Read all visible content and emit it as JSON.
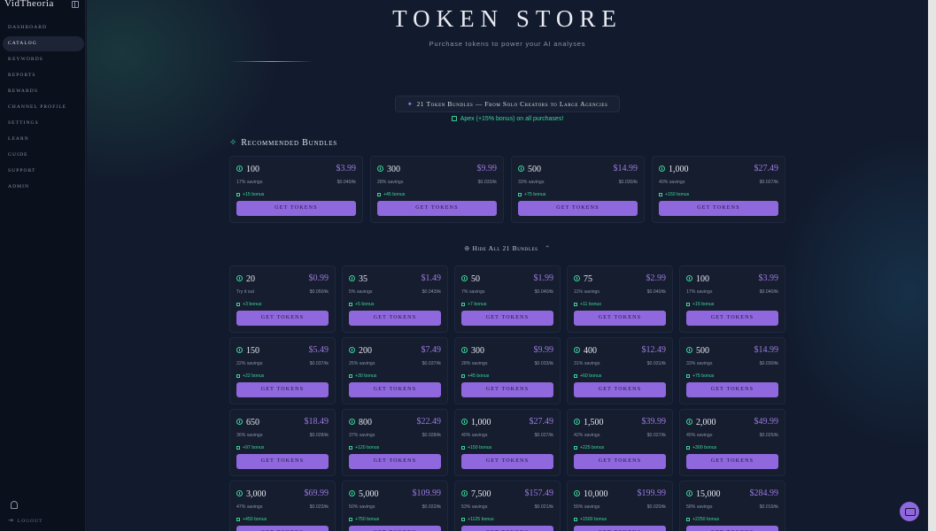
{
  "app": {
    "logo": "VidTheoria"
  },
  "sidebar": {
    "items": [
      {
        "label": "Dashboard",
        "active": false
      },
      {
        "label": "Catalog",
        "active": true
      },
      {
        "label": "Keywords",
        "active": false
      },
      {
        "label": "Reports",
        "active": false
      },
      {
        "label": "Rewards",
        "active": false
      },
      {
        "label": "Channel Profile",
        "active": false
      },
      {
        "label": "Settings",
        "active": false
      },
      {
        "label": "Learn",
        "active": false
      },
      {
        "label": "Guide",
        "active": false
      },
      {
        "label": "Support",
        "active": false
      },
      {
        "label": "Admin",
        "active": false
      }
    ],
    "logout_label": "Logout"
  },
  "header": {
    "title": "Token Store",
    "subtitle": "Purchase tokens to power your AI analyses"
  },
  "banner": {
    "text": "21 Token Bundles — From Solo Creators to Large Agencies",
    "apex_note": "Apex (+15% bonus) on all purchases!"
  },
  "recommended": {
    "title": "Recommended Bundles",
    "bundles": [
      {
        "tokens": "100",
        "price": "$3.99",
        "savings": "17% savings",
        "rate": "$0.040/tk",
        "bonus": "+15 bonus"
      },
      {
        "tokens": "300",
        "price": "$9.99",
        "savings": "28% savings",
        "rate": "$0.033/tk",
        "bonus": "+45 bonus"
      },
      {
        "tokens": "500",
        "price": "$14.99",
        "savings": "33% savings",
        "rate": "$0.030/tk",
        "bonus": "+75 bonus"
      },
      {
        "tokens": "1,000",
        "price": "$27.49",
        "savings": "40% savings",
        "rate": "$0.027/tk",
        "bonus": "+150 bonus"
      }
    ]
  },
  "all_toggle": {
    "label": "Hide All 21 Bundles"
  },
  "buy_label": "Get Tokens",
  "all_bundles": [
    {
      "tokens": "20",
      "price": "$0.99",
      "savings": "Try it out",
      "rate": "$0.050/tk",
      "bonus": "+3 bonus"
    },
    {
      "tokens": "35",
      "price": "$1.49",
      "savings": "5% savings",
      "rate": "$0.043/tk",
      "bonus": "+5 bonus"
    },
    {
      "tokens": "50",
      "price": "$1.99",
      "savings": "7% savings",
      "rate": "$0.040/tk",
      "bonus": "+7 bonus"
    },
    {
      "tokens": "75",
      "price": "$2.99",
      "savings": "11% savings",
      "rate": "$0.040/tk",
      "bonus": "+11 bonus"
    },
    {
      "tokens": "100",
      "price": "$3.99",
      "savings": "17% savings",
      "rate": "$0.040/tk",
      "bonus": "+15 bonus"
    },
    {
      "tokens": "150",
      "price": "$5.49",
      "savings": "22% savings",
      "rate": "$0.037/tk",
      "bonus": "+22 bonus"
    },
    {
      "tokens": "200",
      "price": "$7.49",
      "savings": "25% savings",
      "rate": "$0.037/tk",
      "bonus": "+30 bonus"
    },
    {
      "tokens": "300",
      "price": "$9.99",
      "savings": "28% savings",
      "rate": "$0.033/tk",
      "bonus": "+45 bonus"
    },
    {
      "tokens": "400",
      "price": "$12.49",
      "savings": "31% savings",
      "rate": "$0.031/tk",
      "bonus": "+60 bonus"
    },
    {
      "tokens": "500",
      "price": "$14.99",
      "savings": "33% savings",
      "rate": "$0.030/tk",
      "bonus": "+75 bonus"
    },
    {
      "tokens": "650",
      "price": "$18.49",
      "savings": "36% savings",
      "rate": "$0.028/tk",
      "bonus": "+97 bonus"
    },
    {
      "tokens": "800",
      "price": "$22.49",
      "savings": "37% savings",
      "rate": "$0.028/tk",
      "bonus": "+120 bonus"
    },
    {
      "tokens": "1,000",
      "price": "$27.49",
      "savings": "40% savings",
      "rate": "$0.027/tk",
      "bonus": "+150 bonus"
    },
    {
      "tokens": "1,500",
      "price": "$39.99",
      "savings": "42% savings",
      "rate": "$0.027/tk",
      "bonus": "+225 bonus"
    },
    {
      "tokens": "2,000",
      "price": "$49.99",
      "savings": "45% savings",
      "rate": "$0.025/tk",
      "bonus": "+300 bonus"
    },
    {
      "tokens": "3,000",
      "price": "$69.99",
      "savings": "47% savings",
      "rate": "$0.023/tk",
      "bonus": "+450 bonus"
    },
    {
      "tokens": "5,000",
      "price": "$109.99",
      "savings": "50% savings",
      "rate": "$0.022/tk",
      "bonus": "+750 bonus"
    },
    {
      "tokens": "7,500",
      "price": "$157.49",
      "savings": "53% savings",
      "rate": "$0.021/tk",
      "bonus": "+1125 bonus"
    },
    {
      "tokens": "10,000",
      "price": "$199.99",
      "savings": "55% savings",
      "rate": "$0.020/tk",
      "bonus": "+1500 bonus"
    },
    {
      "tokens": "15,000",
      "price": "$284.99",
      "savings": "58% savings",
      "rate": "$0.019/tk",
      "bonus": "+2250 bonus"
    }
  ],
  "colors": {
    "accent": "#8f68de",
    "bonus": "#3ad69a",
    "background": "#121a2d"
  }
}
